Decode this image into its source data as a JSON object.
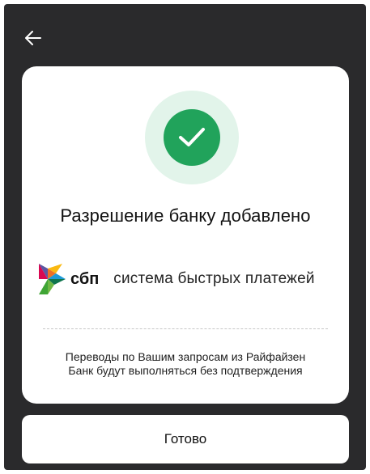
{
  "header": {
    "back_icon": "arrow-left-icon"
  },
  "card": {
    "status_icon": "check-icon",
    "title": "Разрешение банку добавлено",
    "sbp_abbr": "сбп",
    "sbp_full": "система быстрых платежей",
    "note_line1": "Переводы по Вашим запросам из Райфайзен",
    "note_line2": "Банк будут выполняться без подтверждения"
  },
  "footer": {
    "done_label": "Готово"
  },
  "colors": {
    "background": "#2a2a2c",
    "success": "#21a35b",
    "success_halo": "#e2f4ea"
  }
}
